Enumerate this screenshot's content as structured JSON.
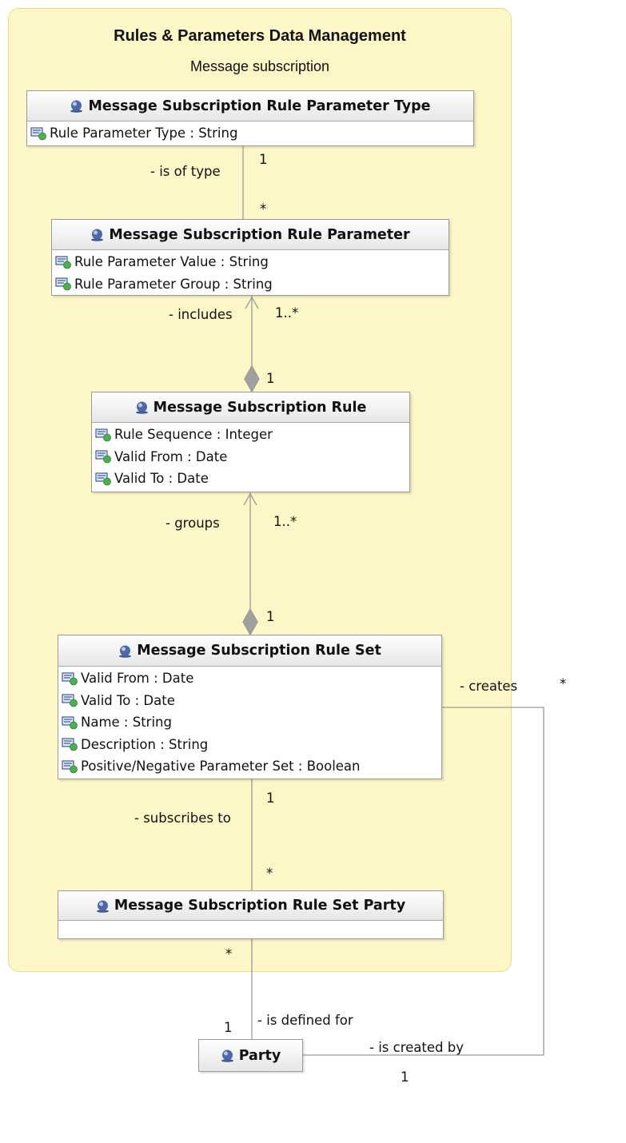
{
  "package": {
    "title": "Rules & Parameters Data Management",
    "subtitle": "Message subscription"
  },
  "classes": {
    "rule_parameter_type": {
      "name": "Message Subscription Rule Parameter Type",
      "attributes": [
        "Rule Parameter Type : String"
      ]
    },
    "rule_parameter": {
      "name": "Message Subscription Rule Parameter",
      "attributes": [
        "Rule Parameter Value : String",
        "Rule Parameter Group : String"
      ]
    },
    "rule": {
      "name": "Message Subscription Rule",
      "attributes": [
        "Rule Sequence : Integer",
        "Valid From : Date",
        "Valid To : Date"
      ]
    },
    "rule_set": {
      "name": "Message Subscription Rule Set",
      "attributes": [
        "Valid From : Date",
        "Valid To : Date",
        "Name : String",
        "Description : String",
        "Positive/Negative Parameter Set : Boolean"
      ]
    },
    "rule_set_party": {
      "name": "Message Subscription Rule Set Party",
      "attributes": []
    },
    "party": {
      "name": "Party",
      "attributes": []
    }
  },
  "associations": {
    "is_of_type": {
      "role": "- is of type",
      "source_mult": "1",
      "target_mult": "*"
    },
    "includes": {
      "role": "- includes",
      "target_mult": "1..*",
      "source_mult": "1"
    },
    "groups": {
      "role": "- groups",
      "target_mult": "1..*",
      "source_mult": "1"
    },
    "creates": {
      "role": "- creates",
      "target_mult": "*"
    },
    "subscribes_to": {
      "role": "- subscribes to",
      "source_mult": "1",
      "target_mult": "*"
    },
    "is_defined_for": {
      "role": "- is defined for",
      "source_mult": "*",
      "target_mult": "1"
    },
    "is_created_by": {
      "role": "- is created by",
      "target_mult": "1"
    }
  },
  "colors": {
    "package_fill": "#fdf6c6",
    "package_border": "#ecd98c",
    "class_header": "#e6e6e6",
    "line": "#9a9a9a",
    "class_icon": "#3f5b95",
    "attribute_icon_dot": "#4caf50"
  }
}
